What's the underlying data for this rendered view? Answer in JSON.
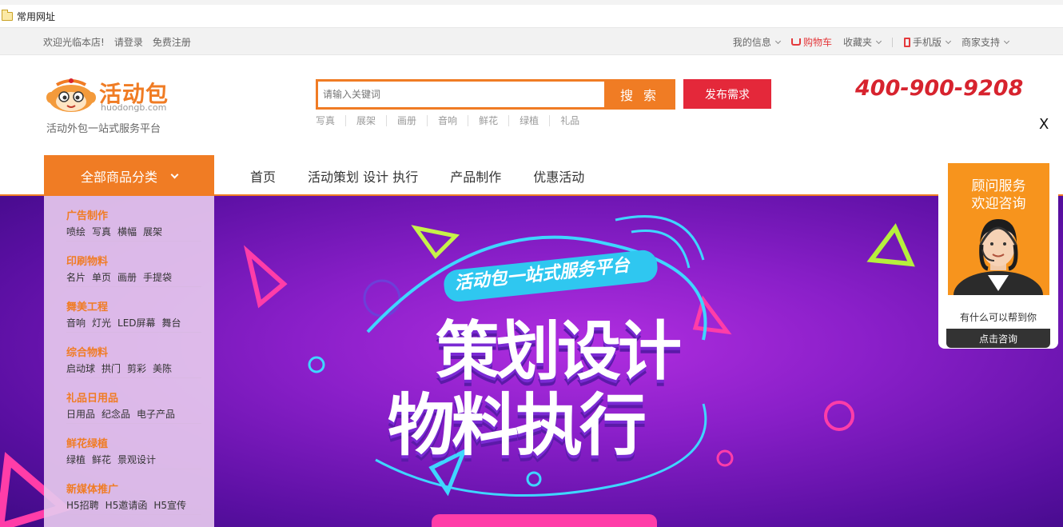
{
  "bookmarks": {
    "folder_label": "常用网址"
  },
  "topbar": {
    "welcome": "欢迎光临本店!",
    "login": "请登录",
    "register": "免费注册",
    "my_info": "我的信息",
    "cart": "购物车",
    "favorites": "收藏夹",
    "mobile": "手机版",
    "merchant": "商家支持"
  },
  "header": {
    "brand": "活动包",
    "domain": "huodongb.com",
    "slogan": "活动外包一站式服务平台",
    "search_placeholder": "请输入关键词",
    "search_button": "搜 索",
    "publish_button": "发布需求",
    "hotline": "400-900-9208",
    "close": "X",
    "hot_words": [
      "写真",
      "展架",
      "画册",
      "音响",
      "鲜花",
      "绿植",
      "礼品"
    ]
  },
  "nav": {
    "all_categories": "全部商品分类",
    "items": [
      "首页",
      "活动策划 设计 执行",
      "产品制作",
      "优惠活动"
    ]
  },
  "categories": [
    {
      "title": "广告制作",
      "subs": [
        "喷绘",
        "写真",
        "横幅",
        "展架"
      ]
    },
    {
      "title": "印刷物料",
      "subs": [
        "名片",
        "单页",
        "画册",
        "手提袋"
      ]
    },
    {
      "title": "舞美工程",
      "subs": [
        "音响",
        "灯光",
        "LED屏幕",
        "舞台"
      ]
    },
    {
      "title": "综合物料",
      "subs": [
        "启动球",
        "拱门",
        "剪彩",
        "美陈"
      ]
    },
    {
      "title": "礼品日用品",
      "subs": [
        "日用品",
        "纪念品",
        "电子产品"
      ]
    },
    {
      "title": "鲜花绿植",
      "subs": [
        "绿植",
        "鲜花",
        "景观设计"
      ]
    },
    {
      "title": "新媒体推广",
      "subs": [
        "H5招聘",
        "H5邀请函",
        "H5宣传"
      ]
    }
  ],
  "banner": {
    "tag": "活动包一站式服务平台",
    "line1": "策划设计",
    "line2": "物料执行"
  },
  "consult": {
    "title_line1": "顾问服务",
    "title_line2": "欢迎咨询",
    "question": "有什么可以帮到你",
    "button": "点击咨询"
  },
  "colors": {
    "accent": "#f07c24",
    "red": "#e4283a",
    "banner_purple": "#8a1fc9"
  }
}
